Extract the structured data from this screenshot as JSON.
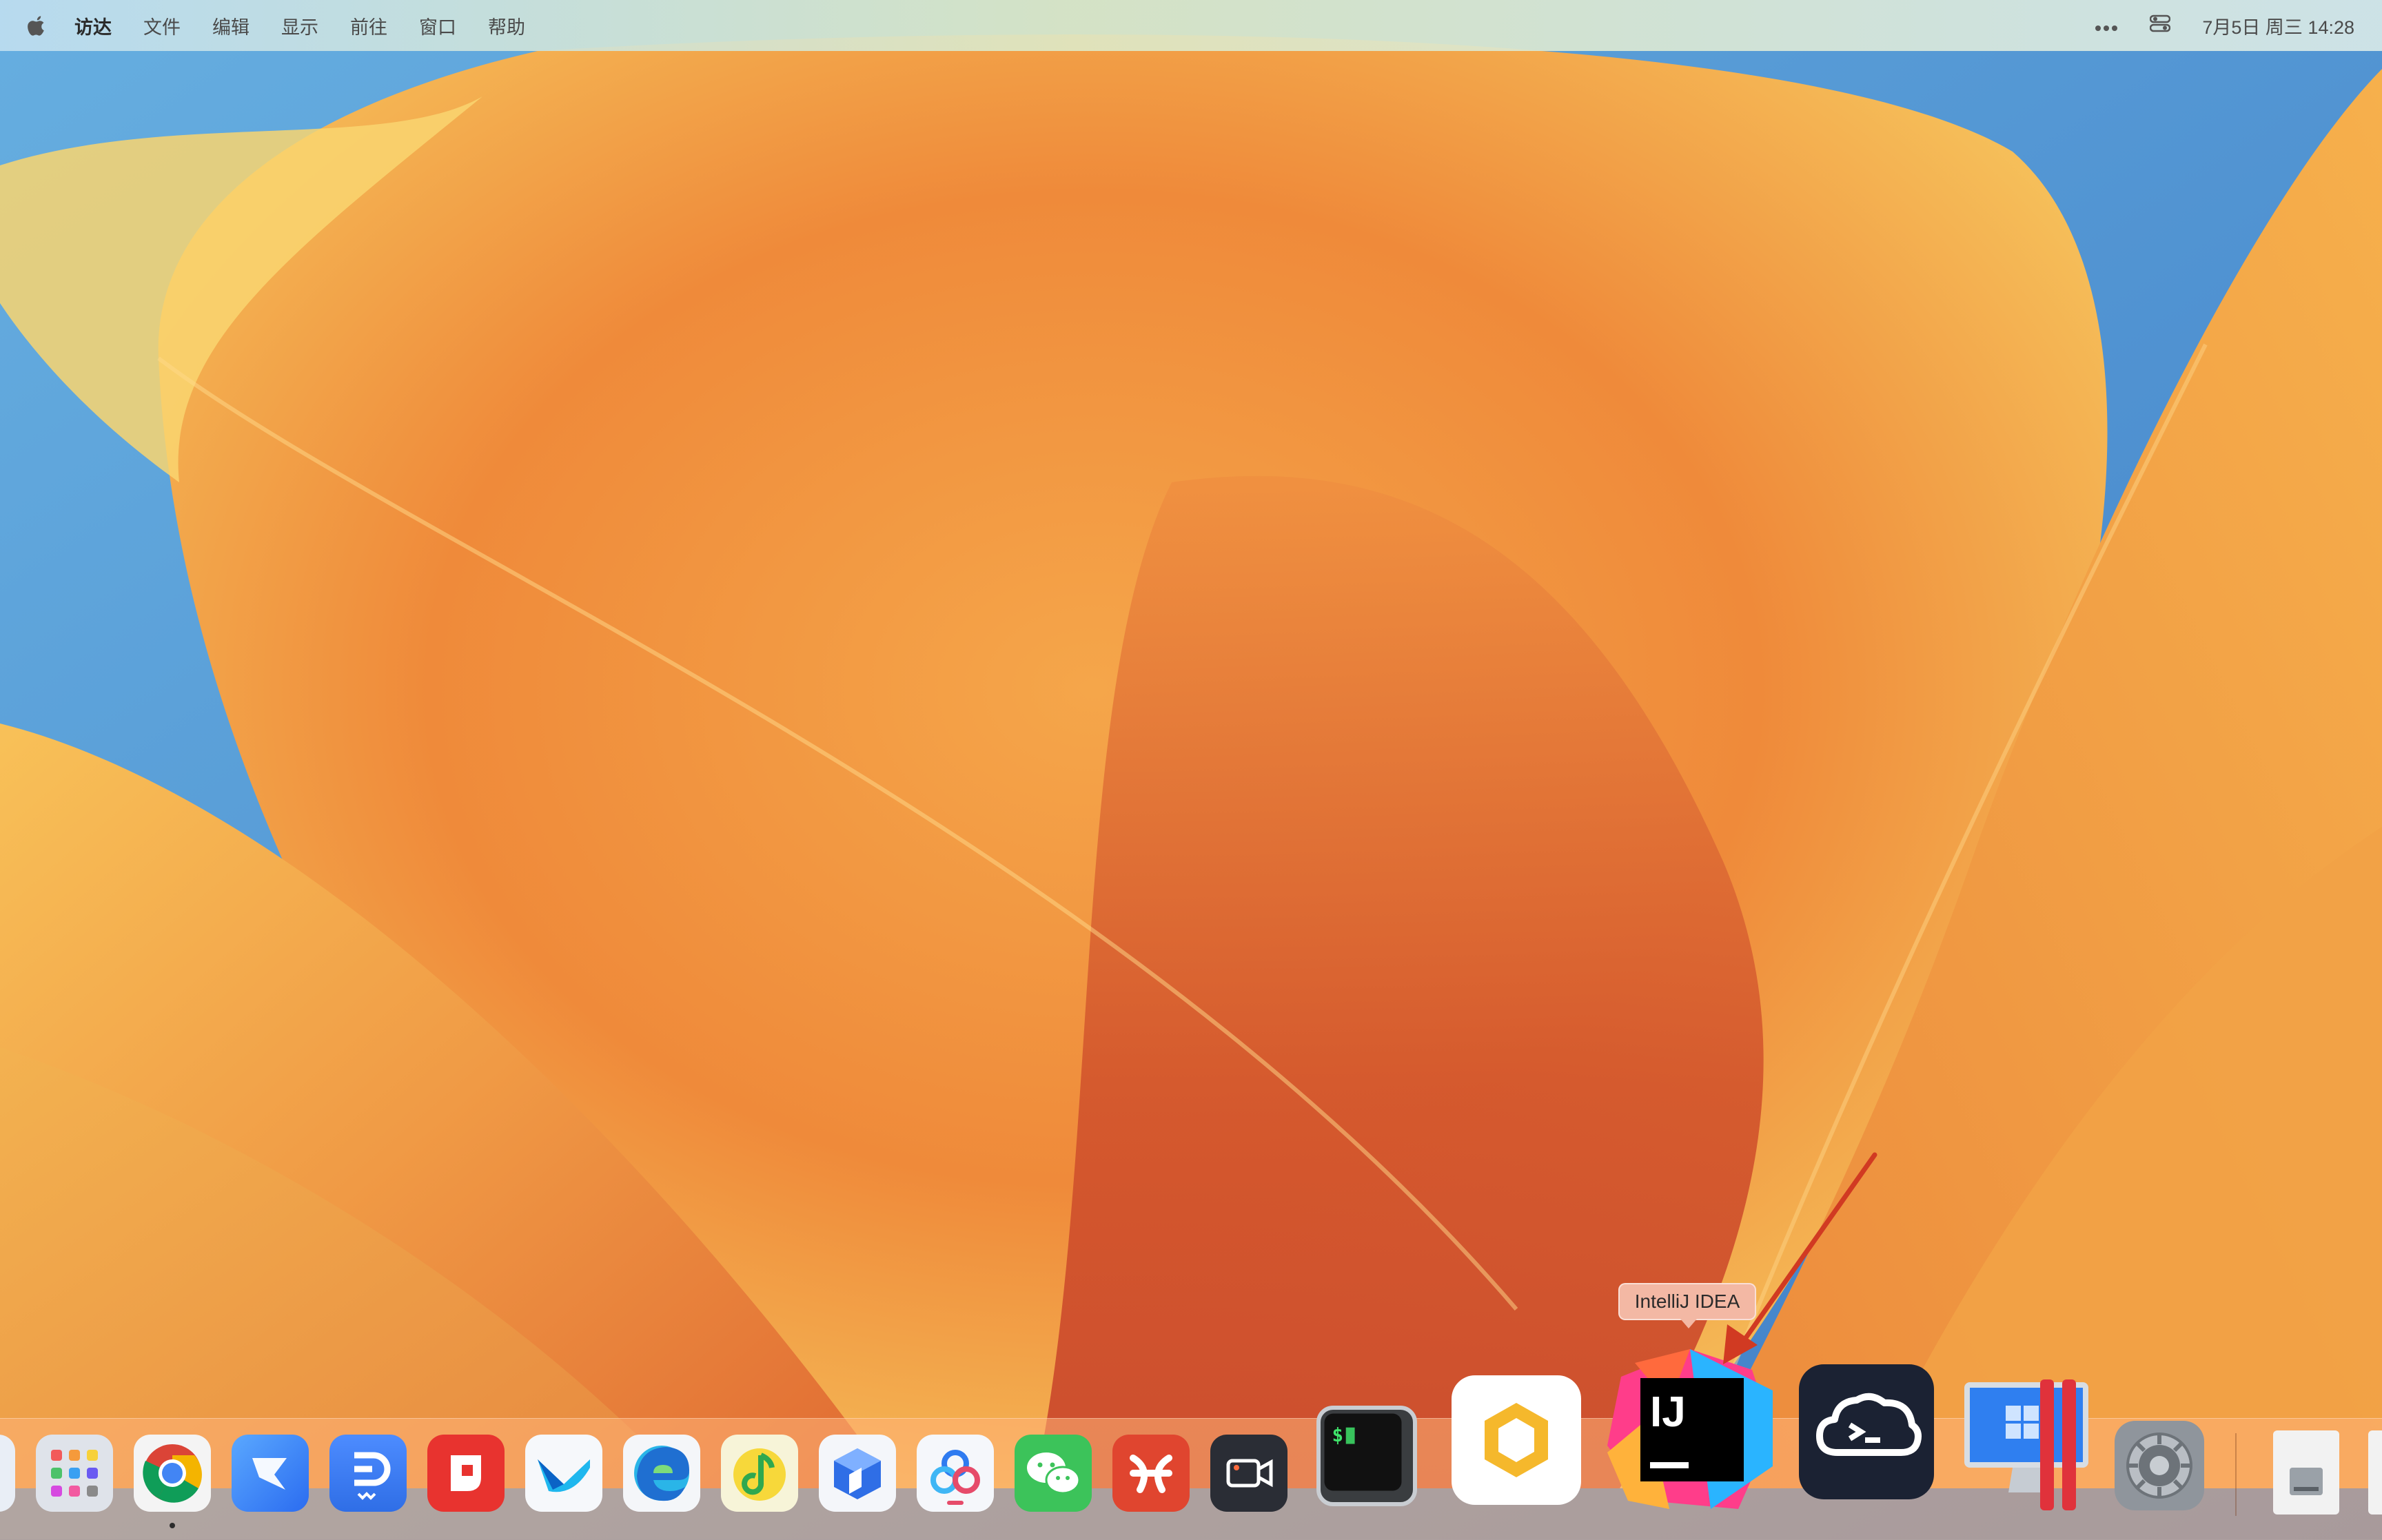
{
  "menubar": {
    "app_name": "访达",
    "items": [
      "文件",
      "编辑",
      "显示",
      "前往",
      "窗口",
      "帮助"
    ],
    "clock": "7月5日 周三 14:28"
  },
  "tooltip": {
    "label": "IntelliJ IDEA"
  },
  "dock": {
    "apps": [
      "finder",
      "launchpad",
      "google-chrome",
      "feishu",
      "lark-docs",
      "wps-office",
      "dingtalk-mail",
      "microsoft-edge",
      "qq-music",
      "box-app",
      "baidu-netdisk",
      "wechat",
      "xmind",
      "screen-recorder",
      "iterm",
      "hex-app",
      "intellij-idea",
      "termius",
      "parallels-desktop",
      "system-settings",
      "disk-image",
      "document"
    ]
  },
  "colors": {
    "wallpaper_orange": "#f29a45",
    "wallpaper_blue": "#4a8bd0",
    "annotation_arrow": "#d13a22",
    "tooltip_bg": "#f3b8a4"
  }
}
